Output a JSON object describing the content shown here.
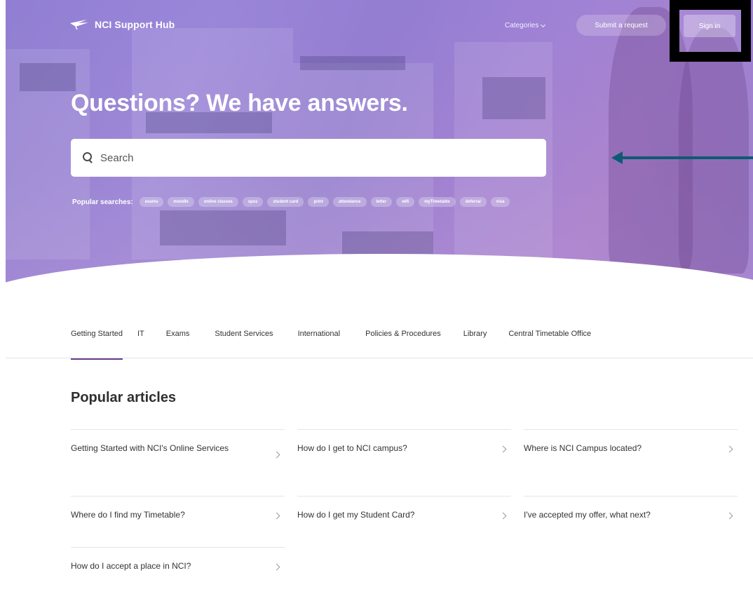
{
  "header": {
    "brand": "NCI Support Hub",
    "categories_label": "Categories",
    "submit_label": "Submit a request",
    "signin_label": "Sign in"
  },
  "hero": {
    "title": "Questions? We have answers.",
    "search_placeholder": "Search",
    "popular_label": "Popular searches:",
    "popular_searches": [
      "exams",
      "moodle",
      "online classes",
      "spss",
      "student card",
      "print",
      "attendance",
      "letter",
      "wifi",
      "myTimetable",
      "deferral",
      "visa"
    ]
  },
  "tabs": [
    "Getting Started",
    "IT",
    "Exams",
    "Student Services",
    "International",
    "Policies & Procedures",
    "Library",
    "Central Timetable Office"
  ],
  "active_tab": "Getting Started",
  "articles": {
    "title": "Popular articles",
    "columns": [
      [
        "Getting Started with NCI's Online Services",
        "Where do I find my Timetable?",
        "How do I accept a place in NCI?"
      ],
      [
        "How do I get to NCI campus?",
        "How do I get my Student Card?"
      ],
      [
        "Where is NCI Campus located?",
        "I've accepted my offer, what next?"
      ]
    ]
  },
  "colors": {
    "accent": "#6d3b8d",
    "arrow": "#0e5a73",
    "highlight_frame": "#000000"
  },
  "icons": {
    "logo": "nci-logo-icon",
    "search": "search-icon",
    "chevron": "chevron-right-icon",
    "dropdown": "chevron-down-icon",
    "annotation": "arrow-left-icon"
  }
}
